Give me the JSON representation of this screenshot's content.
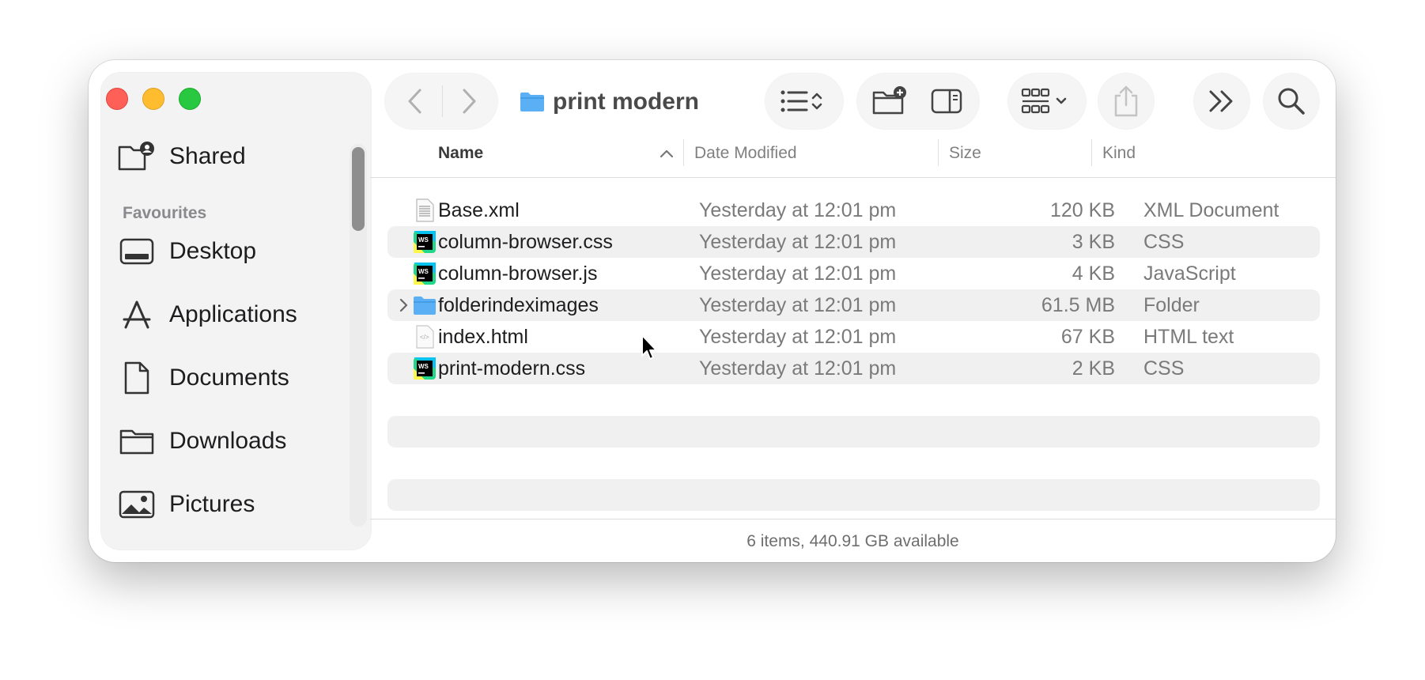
{
  "window": {
    "title": "print modern"
  },
  "sidebar": {
    "top_item": {
      "label": "Shared",
      "icon": "shared-folder-icon"
    },
    "section_title": "Favourites",
    "items": [
      {
        "label": "Desktop",
        "icon": "desktop-icon"
      },
      {
        "label": "Applications",
        "icon": "applications-icon"
      },
      {
        "label": "Documents",
        "icon": "document-icon"
      },
      {
        "label": "Downloads",
        "icon": "folder-icon"
      },
      {
        "label": "Pictures",
        "icon": "pictures-icon"
      }
    ]
  },
  "toolbar": {
    "back_icon": "chevron-left-icon",
    "forward_icon": "chevron-right-icon",
    "view_icon": "list-view-icon",
    "new_folder_icon": "new-folder-icon",
    "preview_icon": "preview-pane-icon",
    "group_icon": "group-grid-icon",
    "share_icon": "share-icon",
    "more_icon": "more-chevrons-icon",
    "search_icon": "search-icon"
  },
  "columns": {
    "name": "Name",
    "date": "Date Modified",
    "size": "Size",
    "kind": "Kind"
  },
  "files": [
    {
      "name": "Base.xml",
      "date": "Yesterday at 12:01 pm",
      "size": "120 KB",
      "kind": "XML Document",
      "icon": "xml-file-icon"
    },
    {
      "name": "column-browser.css",
      "date": "Yesterday at 12:01 pm",
      "size": "3 KB",
      "kind": "CSS",
      "icon": "webstorm-file-icon"
    },
    {
      "name": "column-browser.js",
      "date": "Yesterday at 12:01 pm",
      "size": "4 KB",
      "kind": "JavaScript",
      "icon": "webstorm-file-icon"
    },
    {
      "name": "folderindeximages",
      "date": "Yesterday at 12:01 pm",
      "size": "61.5 MB",
      "kind": "Folder",
      "icon": "folder-icon"
    },
    {
      "name": "index.html",
      "date": "Yesterday at 12:01 pm",
      "size": "67 KB",
      "kind": "HTML text",
      "icon": "html-file-icon"
    },
    {
      "name": "print-modern.css",
      "date": "Yesterday at 12:01 pm",
      "size": "2 KB",
      "kind": "CSS",
      "icon": "webstorm-file-icon"
    }
  ],
  "status": {
    "text": "6 items, 440.91 GB available"
  },
  "colors": {
    "accent_folder": "#5bb0f5",
    "close": "#fe5f57",
    "minimize": "#febc2e",
    "zoom": "#28c840"
  }
}
